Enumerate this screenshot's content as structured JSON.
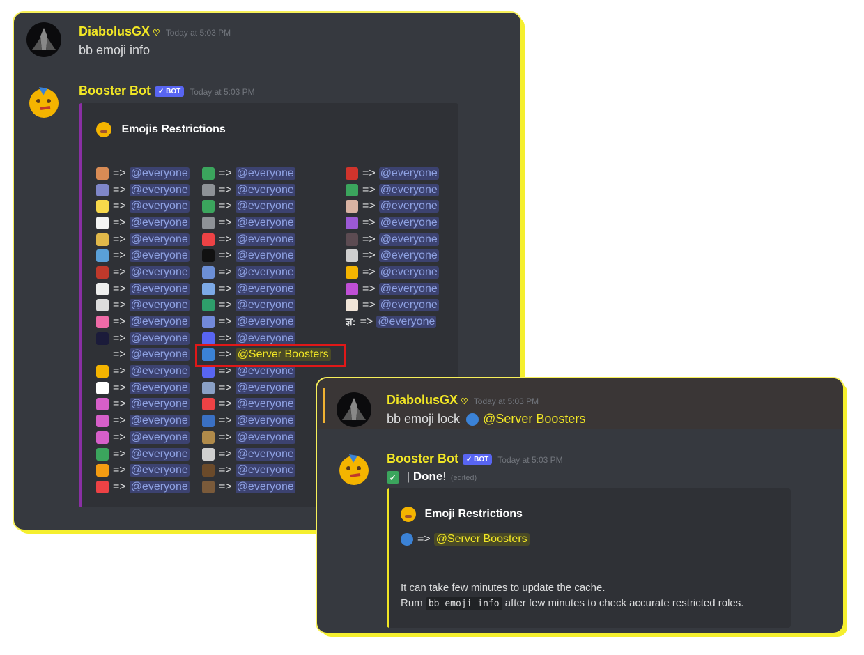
{
  "panel1": {
    "user_message": {
      "username": "DiabolusGX",
      "timestamp": "Today at 5:03 PM",
      "text": "bb emoji info"
    },
    "bot_message": {
      "username": "Booster Bot",
      "badge": "✓ BOT",
      "timestamp": "Today at 5:03 PM",
      "embed_title": "Emojis Restrictions",
      "columns": [
        [
          {
            "emoji_color": "#d88b55",
            "role": "@everyone"
          },
          {
            "emoji_color": "#7f86c9",
            "role": "@everyone"
          },
          {
            "emoji_color": "#f7d84b",
            "role": "@everyone"
          },
          {
            "emoji_color": "#f4f4f4",
            "role": "@everyone"
          },
          {
            "emoji_color": "#e0b84a",
            "role": "@everyone"
          },
          {
            "emoji_color": "#5aa0d8",
            "role": "@everyone"
          },
          {
            "emoji_color": "#c0392b",
            "role": "@everyone"
          },
          {
            "emoji_color": "#eeeeee",
            "role": "@everyone"
          },
          {
            "emoji_color": "#dddddd",
            "role": "@everyone"
          },
          {
            "emoji_color": "#ee6aa7",
            "role": "@everyone"
          },
          {
            "emoji_color": "#1b1b3a",
            "role": "@everyone"
          },
          {
            "emoji_color": "",
            "role": "@everyone"
          },
          {
            "emoji_color": "#f4b400",
            "role": "@everyone"
          },
          {
            "emoji_color": "#ffffff",
            "role": "@everyone"
          },
          {
            "emoji_color": "#d65fc9",
            "role": "@everyone"
          },
          {
            "emoji_color": "#d65fc9",
            "role": "@everyone"
          },
          {
            "emoji_color": "#d65fc9",
            "role": "@everyone"
          },
          {
            "emoji_color": "#3ba55d",
            "role": "@everyone"
          },
          {
            "emoji_color": "#f39c12",
            "role": "@everyone"
          },
          {
            "emoji_color": "#ed4245",
            "role": "@everyone"
          }
        ],
        [
          {
            "emoji_color": "#3ba55d",
            "role": "@everyone"
          },
          {
            "emoji_color": "#8e9297",
            "role": "@everyone"
          },
          {
            "emoji_color": "#3ba55d",
            "role": "@everyone"
          },
          {
            "emoji_color": "#8e9297",
            "role": "@everyone"
          },
          {
            "emoji_color": "#ed4245",
            "role": "@everyone"
          },
          {
            "emoji_color": "#111111",
            "role": "@everyone"
          },
          {
            "emoji_color": "#6c8fd6",
            "role": "@everyone"
          },
          {
            "emoji_color": "#7ca9e6",
            "role": "@everyone"
          },
          {
            "emoji_color": "#2e9e6b",
            "role": "@everyone"
          },
          {
            "emoji_color": "#7289da",
            "role": "@everyone"
          },
          {
            "emoji_color": "#5865f2",
            "role": "@everyone"
          },
          {
            "emoji_color": "#3b82d6",
            "role": "@Server Boosters",
            "highlight": true
          },
          {
            "emoji_color": "#5865f2",
            "role": "@everyone"
          },
          {
            "emoji_color": "#8aa0c6",
            "role": "@everyone"
          },
          {
            "emoji_color": "#ed4245",
            "role": "@everyone"
          },
          {
            "emoji_color": "#3a70c4",
            "role": "@everyone"
          },
          {
            "emoji_color": "#b08a4a",
            "role": "@everyone"
          },
          {
            "emoji_color": "#cfcfcf",
            "role": "@everyone"
          },
          {
            "emoji_color": "#6b4a2a",
            "role": "@everyone"
          },
          {
            "emoji_color": "#7a5a3a",
            "role": "@everyone"
          }
        ],
        [
          {
            "emoji_color": "#d0342c",
            "role": "@everyone"
          },
          {
            "emoji_color": "#3ba55d",
            "role": "@everyone"
          },
          {
            "emoji_color": "#d9b3a3",
            "role": "@everyone"
          },
          {
            "emoji_color": "#9b59d6",
            "role": "@everyone"
          },
          {
            "emoji_color": "#5c4b52",
            "role": "@everyone"
          },
          {
            "emoji_color": "#cfcfcf",
            "role": "@everyone"
          },
          {
            "emoji_color": "#f4b400",
            "role": "@everyone"
          },
          {
            "emoji_color": "#c04fd6",
            "role": "@everyone"
          },
          {
            "emoji_color": "#f0e4d8",
            "role": "@everyone"
          },
          {
            "emoji_color": "#dcddde",
            "role": "@everyone",
            "glyph": "ज्ञ:"
          }
        ]
      ]
    }
  },
  "panel2": {
    "user_message": {
      "username": "DiabolusGX",
      "timestamp": "Today at 5:03 PM",
      "text": "bb emoji lock",
      "mention": "@Server Boosters"
    },
    "bot_message": {
      "username": "Booster Bot",
      "badge": "✓ BOT",
      "timestamp": "Today at 5:03 PM",
      "done_sep": "|",
      "done_text": "Done",
      "done_excl": "!",
      "edited": "(edited)",
      "embed_title": "Emoji Restrictions",
      "arrow": "=>",
      "role": "@Server Boosters",
      "note_line1": "It can take few minutes to update the cache.",
      "note_prefix": "Rum",
      "note_code": "bb emoji info",
      "note_suffix": "after few minutes to check accurate restricted roles."
    }
  },
  "colors": {
    "accent_yellow": "#f1e625",
    "blurple": "#5865f2",
    "embed_bar_purple": "#8a2fa4",
    "embed_bar_yellow": "#f1e625",
    "highlight_red": "#e01818"
  }
}
